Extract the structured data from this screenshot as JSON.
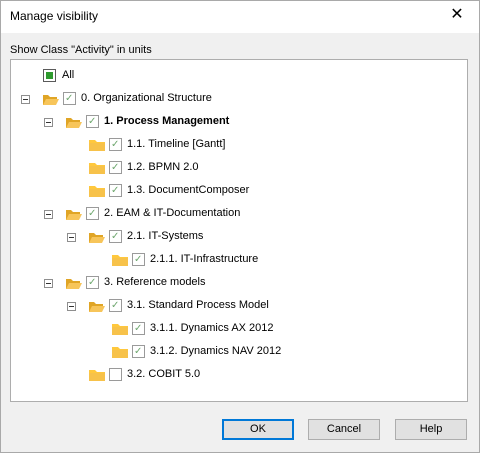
{
  "window": {
    "title": "Manage visibility",
    "close_glyph": "✕"
  },
  "caption": "Show Class \"Activity\" in units",
  "colors": {
    "folder": "#ffc83d",
    "folder_dark": "#e0a526",
    "checkmark": "#6fa86f",
    "all_fill": "#2e9a2e",
    "default_button_border": "#0078d7"
  },
  "tree": {
    "all_label": "All",
    "nodes": [
      {
        "label": "0. Organizational Structure",
        "checked": true,
        "expanded": true,
        "folder": "open",
        "bold": false
      },
      {
        "label": "1. Process Management",
        "checked": true,
        "expanded": true,
        "folder": "open",
        "bold": true
      },
      {
        "label": "1.1. Timeline [Gantt]",
        "checked": true,
        "folder": "closed",
        "bold": false
      },
      {
        "label": "1.2. BPMN 2.0",
        "checked": true,
        "folder": "closed",
        "bold": false
      },
      {
        "label": "1.3. DocumentComposer",
        "checked": true,
        "folder": "closed",
        "bold": false
      },
      {
        "label": "2. EAM & IT-Documentation",
        "checked": true,
        "expanded": true,
        "folder": "open",
        "bold": false
      },
      {
        "label": "2.1. IT-Systems",
        "checked": true,
        "expanded": true,
        "folder": "open",
        "bold": false
      },
      {
        "label": "2.1.1. IT-Infrastructure",
        "checked": true,
        "folder": "closed",
        "bold": false
      },
      {
        "label": "3. Reference models",
        "checked": true,
        "expanded": true,
        "folder": "open",
        "bold": false
      },
      {
        "label": "3.1. Standard Process Model",
        "checked": true,
        "expanded": true,
        "folder": "open",
        "bold": false
      },
      {
        "label": "3.1.1. Dynamics AX 2012",
        "checked": true,
        "folder": "closed",
        "bold": false
      },
      {
        "label": "3.1.2. Dynamics NAV 2012",
        "checked": true,
        "folder": "closed",
        "bold": false
      },
      {
        "label": "3.2. COBIT 5.0",
        "checked": false,
        "folder": "closed",
        "bold": false
      }
    ]
  },
  "buttons": {
    "ok": "OK",
    "cancel": "Cancel",
    "help": "Help"
  }
}
